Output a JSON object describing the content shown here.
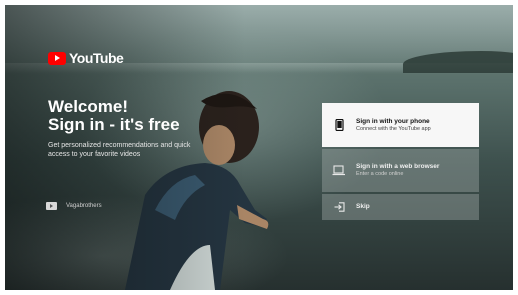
{
  "brand": {
    "logo_text": "YouTube"
  },
  "welcome": {
    "title": "Welcome!",
    "subtitle": "Sign in - it's free",
    "description": "Get personalized recommendations and quick access to your favorite videos"
  },
  "account": {
    "name": "Vagabrothers"
  },
  "options": {
    "phone": {
      "title": "Sign in with your phone",
      "subtitle": "Connect with the YouTube app",
      "icon": "phone-icon"
    },
    "web": {
      "title": "Sign in with a web browser",
      "subtitle": "Enter a code online",
      "icon": "laptop-icon"
    },
    "skip": {
      "title": "Skip",
      "icon": "exit-icon"
    }
  },
  "colors": {
    "brand_red": "#ff0000",
    "selected_option_bg": "#f7f7f7"
  }
}
